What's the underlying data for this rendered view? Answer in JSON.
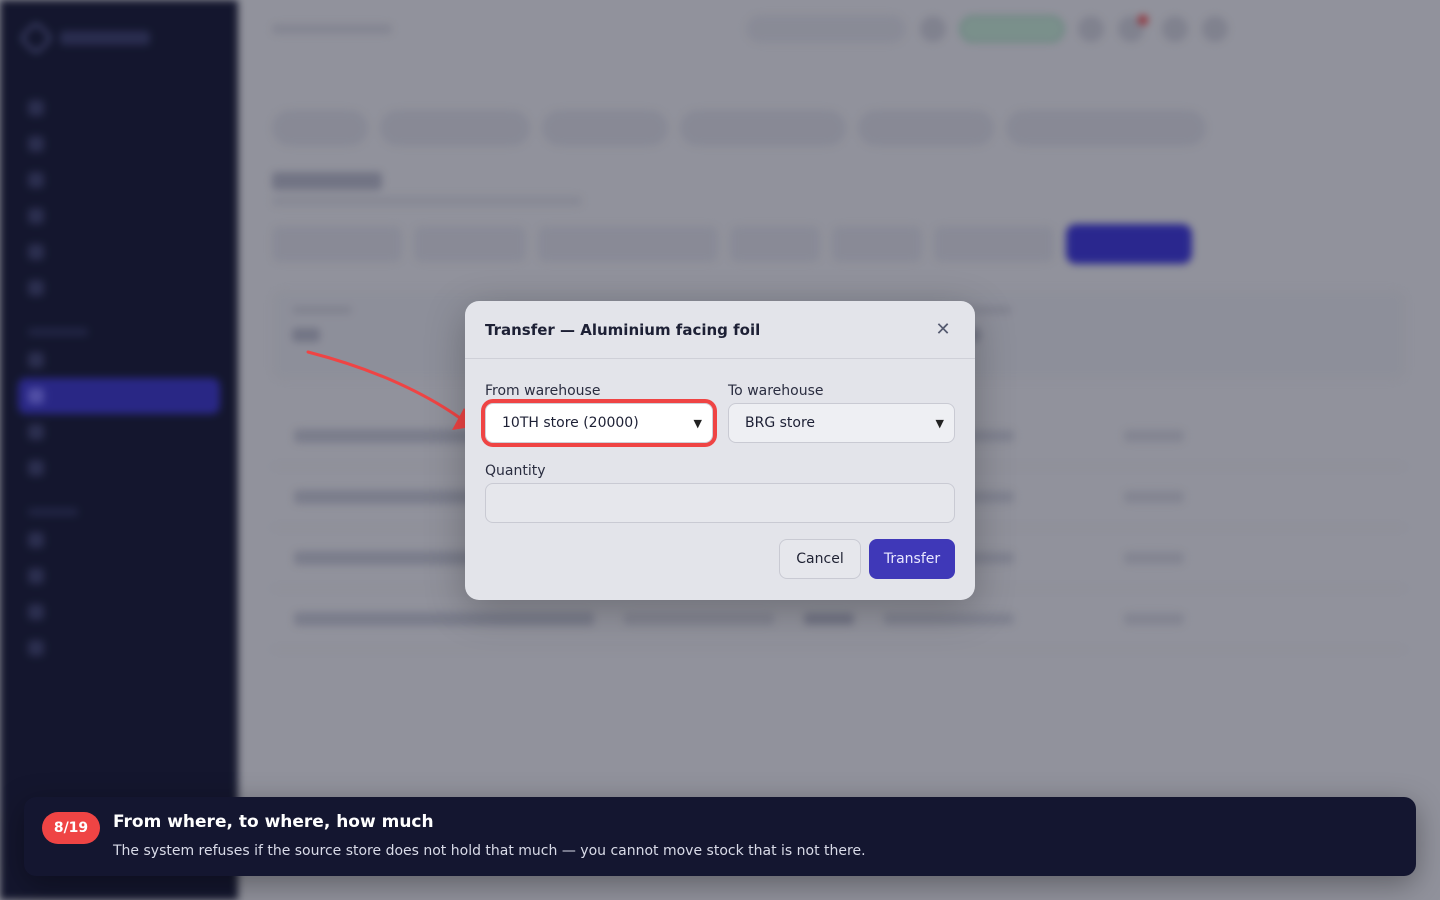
{
  "modal": {
    "title": "Transfer — Aluminium facing foil",
    "from_label": "From warehouse",
    "from_value": "10TH store (20000)",
    "to_label": "To warehouse",
    "to_value": "BRG store",
    "quantity_label": "Quantity",
    "quantity_value": "",
    "cancel_label": "Cancel",
    "transfer_label": "Transfer"
  },
  "tour": {
    "step": "8/19",
    "title": "From where, to where, how much",
    "description": "The system refuses if the source store does not hold that much — you cannot move stock that is not there."
  },
  "colors": {
    "accent": "#3f38b8",
    "highlight": "#ef4444",
    "banner": "#141630"
  },
  "icons": [
    "close-icon",
    "chevron-down-icon",
    "pointer-arrow-icon"
  ]
}
